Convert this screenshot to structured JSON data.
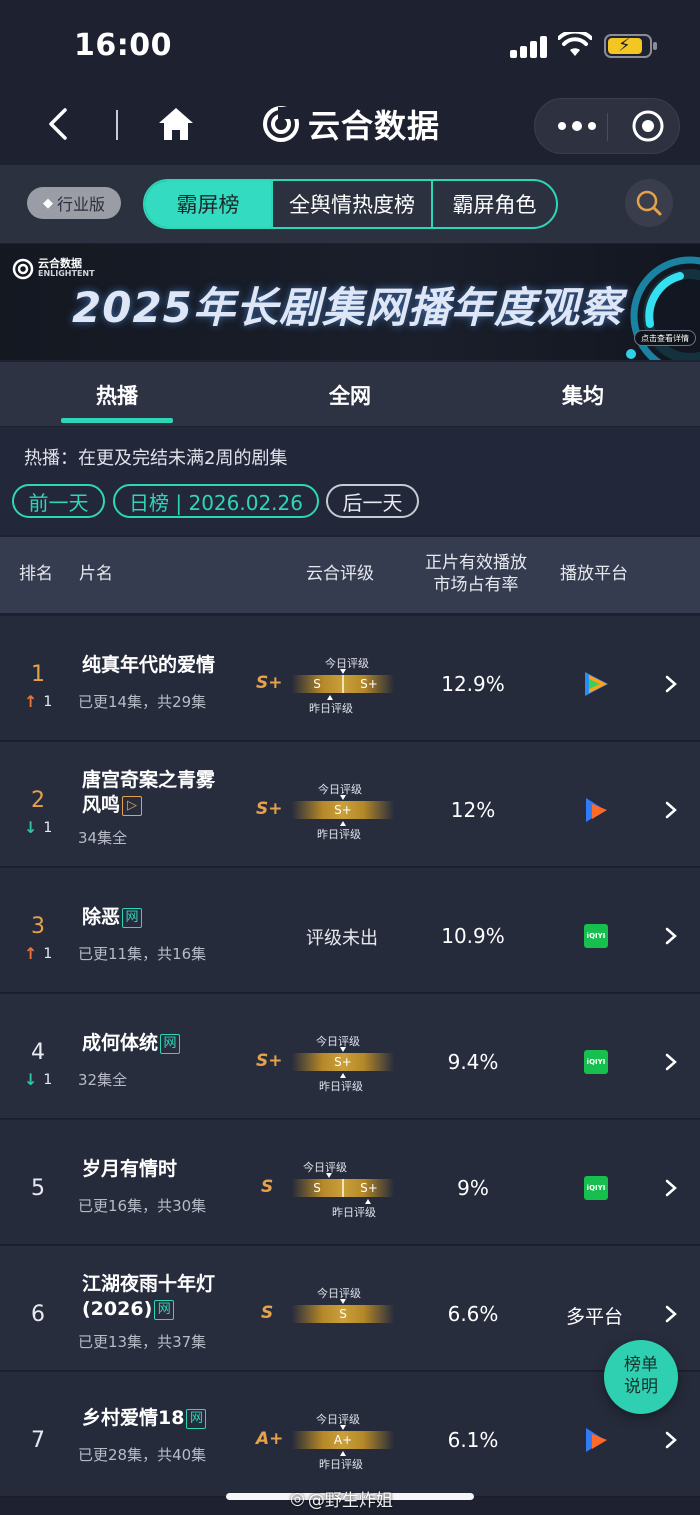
{
  "status_bar": {
    "time": "16:00"
  },
  "nav": {
    "title": "云合数据"
  },
  "tabs": {
    "edition": "行业版",
    "items": [
      "霸屏榜",
      "全舆情热度榜",
      "霸屏角色"
    ]
  },
  "banner": {
    "logo_cn": "云合数据",
    "logo_en": "ENLIGHTENT",
    "headline": "2025年长剧集网播年度观察",
    "cta": "点击查看详情"
  },
  "sub_tabs": [
    "热播",
    "全网",
    "集均"
  ],
  "info": {
    "description": "热播：在更及完结未满2周的剧集",
    "prev": "前一天",
    "date": "日榜 | 2026.02.26",
    "next": "后一天"
  },
  "header": {
    "rank": "排名",
    "name": "片名",
    "rating": "云合评级",
    "share_line1": "正片有效播放",
    "share_line2": "市场占有率",
    "platform": "播放平台"
  },
  "rating_labels": {
    "today": "今日评级",
    "yesterday": "昨日评级",
    "none": "评级未出"
  },
  "rows": [
    {
      "rank": "1",
      "change": "1",
      "title": "纯真年代的爱情",
      "tag": "",
      "sub": "已更14集，共29集",
      "grade": "S+",
      "bar_left": "S",
      "bar_right": "S+",
      "share": "12.9%",
      "platform": "tencent-video"
    },
    {
      "rank": "2",
      "change": "1",
      "title": "唐宫奇案之青雾风鸣",
      "tag": "▷",
      "sub": "34集全",
      "grade": "S+",
      "bar_center": "S+",
      "share": "12%",
      "platform": "youku"
    },
    {
      "rank": "3",
      "change": "1",
      "title": "除恶",
      "tag": "网",
      "sub": "已更11集，共16集",
      "grade": "",
      "share": "10.9%",
      "platform": "iqiyi"
    },
    {
      "rank": "4",
      "change": "1",
      "title": "成何体统",
      "tag": "网",
      "sub": "32集全",
      "grade": "S+",
      "bar_center": "S+",
      "share": "9.4%",
      "platform": "iqiyi"
    },
    {
      "rank": "5",
      "change": "",
      "title": "岁月有情时",
      "tag": "",
      "sub": "已更16集，共30集",
      "grade": "S",
      "bar_left": "S",
      "bar_right": "S+",
      "share": "9%",
      "platform": "iqiyi"
    },
    {
      "rank": "6",
      "change": "",
      "title": "江湖夜雨十年灯(2026)",
      "tag": "网",
      "sub": "已更13集，共37集",
      "grade": "S",
      "bar_center": "S",
      "share": "6.6%",
      "platform": "多平台"
    },
    {
      "rank": "7",
      "change": "",
      "title": "乡村爱情18",
      "tag": "网",
      "sub": "已更28集，共40集",
      "grade": "A+",
      "bar_center": "A+",
      "share": "6.1%",
      "platform": "youku"
    }
  ],
  "platform_text": {
    "iqiyi": "iQIYI"
  },
  "float_button": {
    "line1": "榜单",
    "line2": "说明"
  },
  "watermark": {
    "handle": "@野生炸姐"
  },
  "colors": {
    "accent": "#2ed6b8",
    "gold": "#e6a24a",
    "up": "#e8733a",
    "down": "#2ec6a6"
  }
}
